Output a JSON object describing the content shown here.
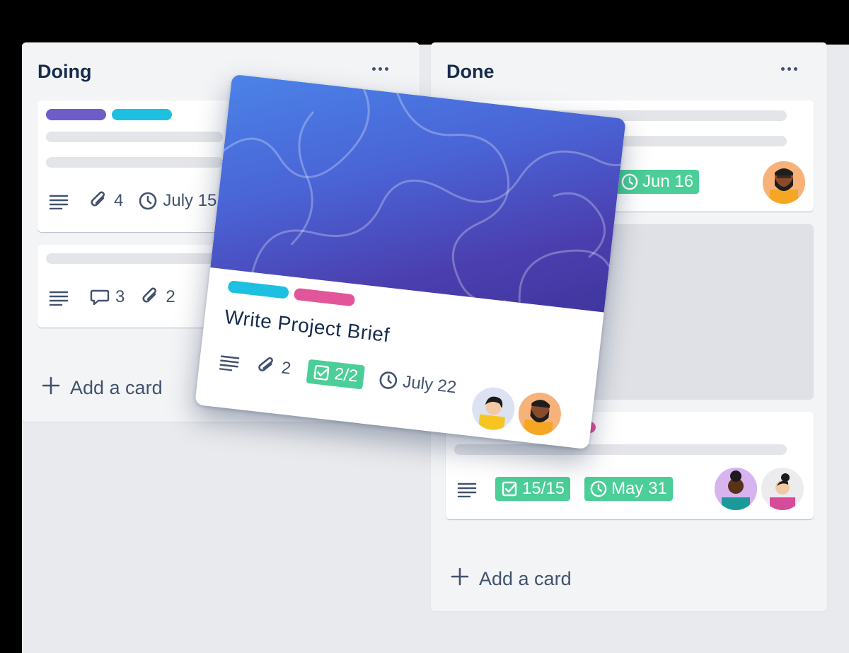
{
  "lists": {
    "doing": {
      "title": "Doing",
      "cards": [
        {
          "attachments": "4",
          "due": "July 15"
        },
        {
          "comments": "3",
          "attachments": "2"
        }
      ],
      "add_label": "Add a card"
    },
    "done": {
      "title": "Done",
      "cards": [
        {
          "due": "Jun 16"
        },
        {
          "checklist": "15/15",
          "due": "May 31"
        }
      ],
      "add_label": "Add a card"
    }
  },
  "dragged_card": {
    "title": "Write Project Brief",
    "attachments": "2",
    "checklist": "2/2",
    "due": "July 22"
  },
  "colors": {
    "label_purple": "#6e5dc6",
    "label_cyan": "#1dc0e0",
    "label_pink": "#e2559b",
    "badge_green": "#4bce97"
  },
  "icons": [
    "description-icon",
    "attachment-icon",
    "clock-icon",
    "comment-icon",
    "checklist-icon",
    "plus-icon",
    "more-icon"
  ]
}
